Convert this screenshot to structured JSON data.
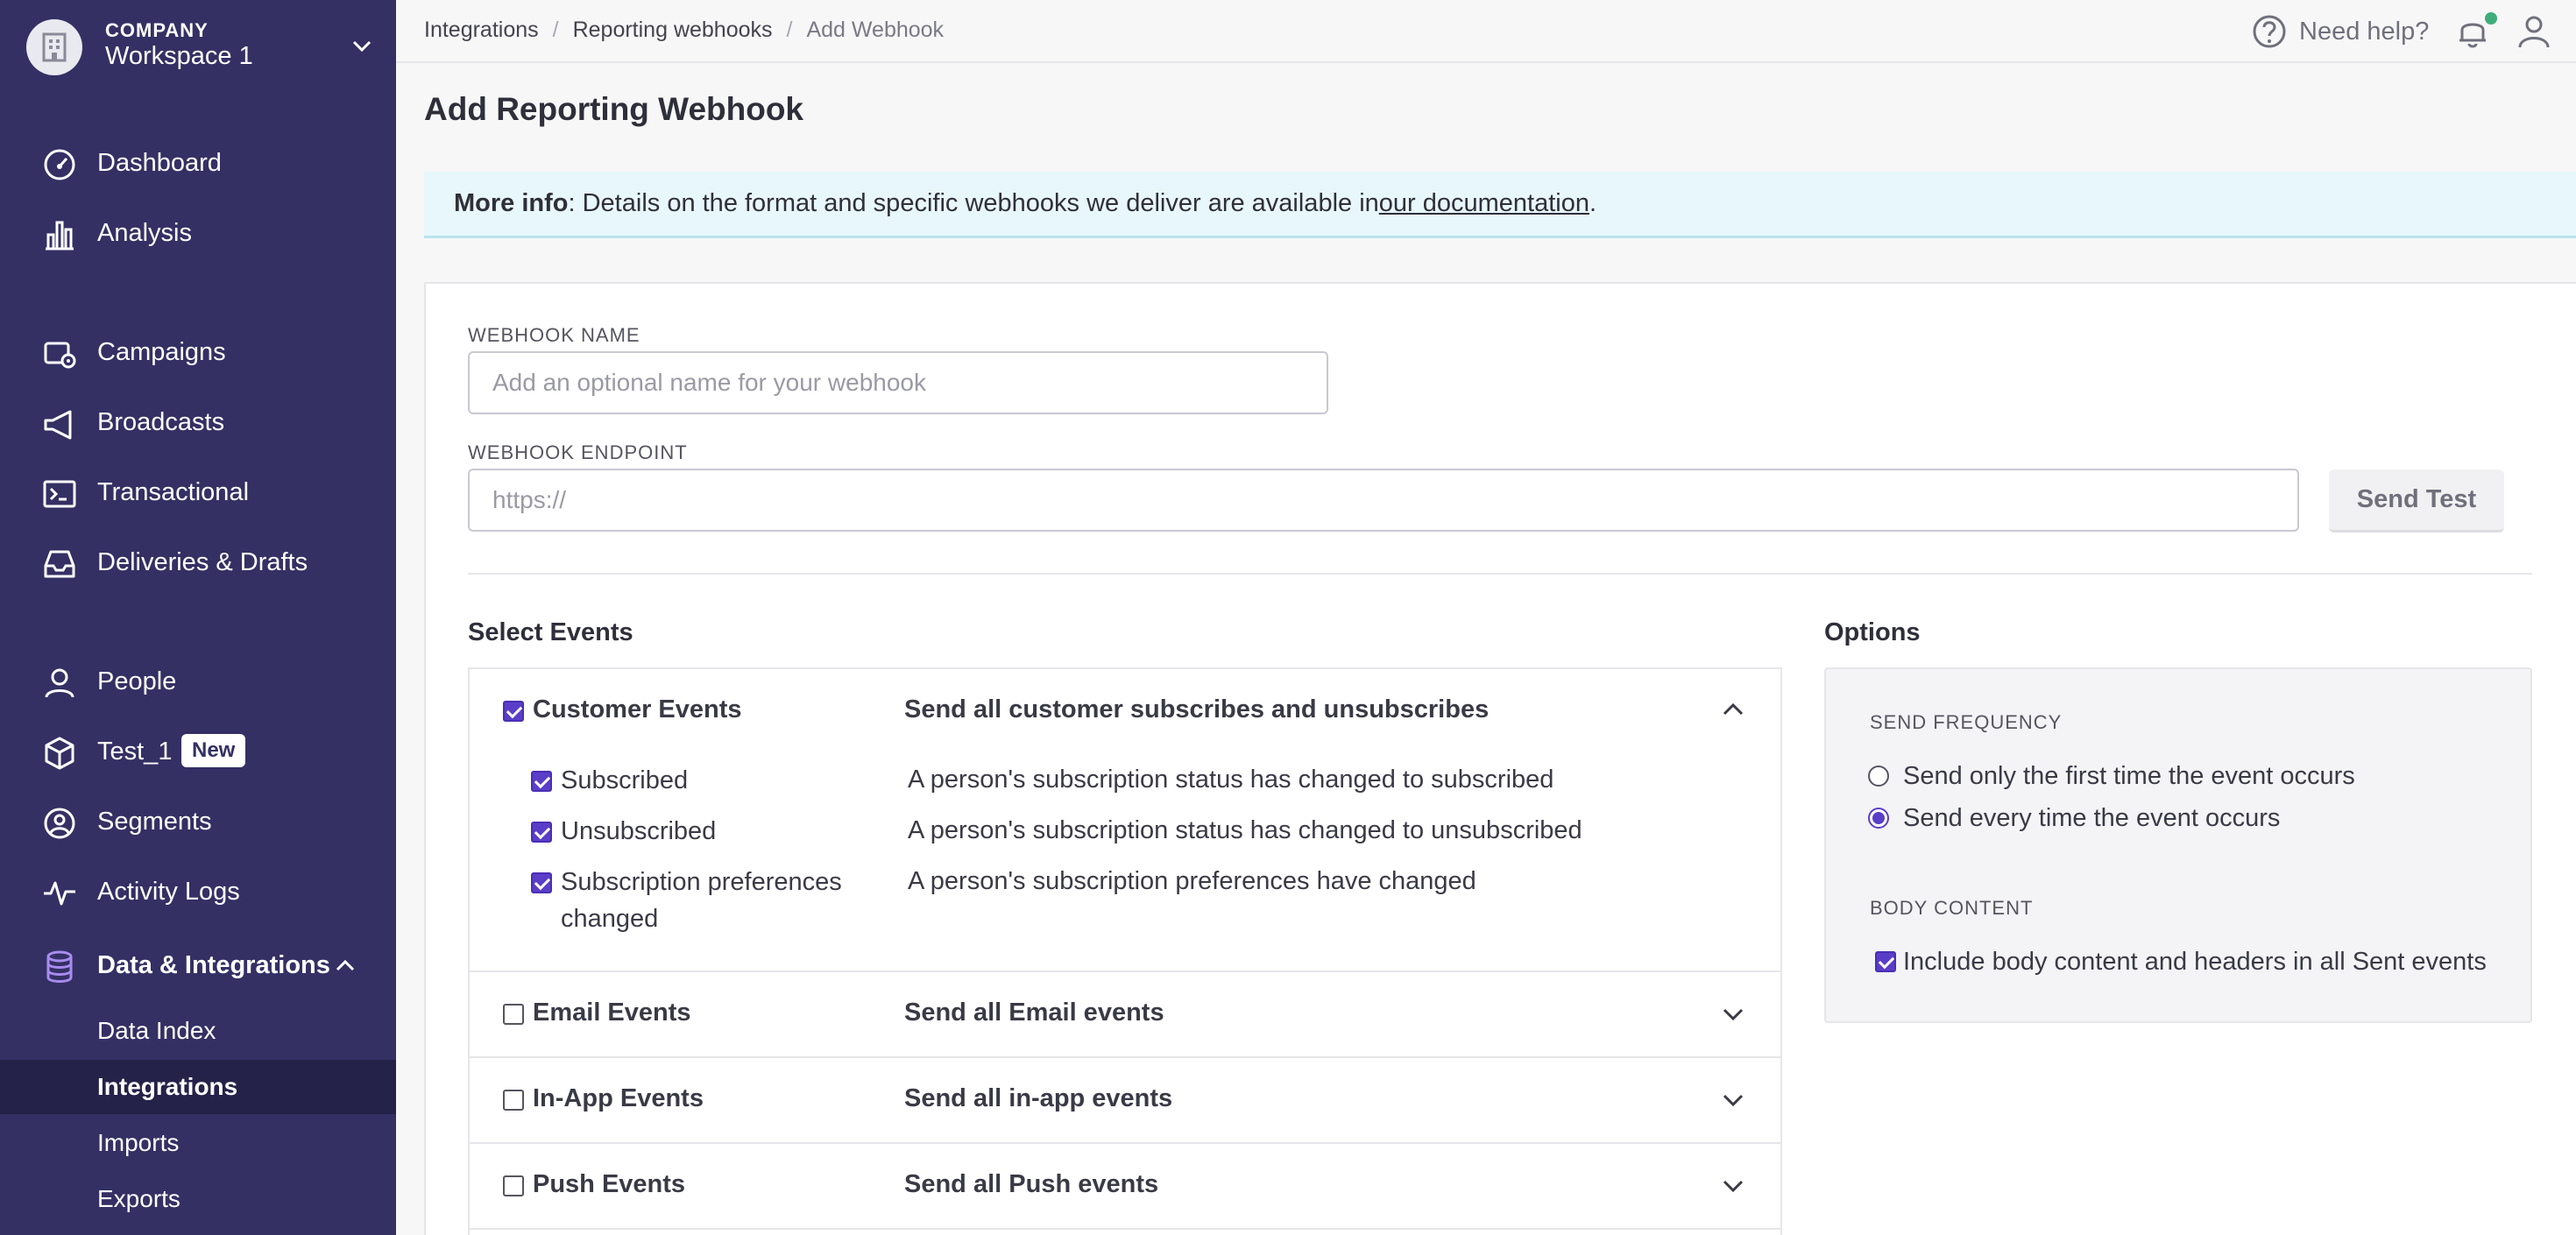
{
  "workspace": {
    "company": "COMPANY",
    "name": "Workspace 1"
  },
  "nav": {
    "dashboard": "Dashboard",
    "analysis": "Analysis",
    "campaigns": "Campaigns",
    "broadcasts": "Broadcasts",
    "transactional": "Transactional",
    "deliveries": "Deliveries & Drafts",
    "people": "People",
    "test1": "Test_1",
    "test1_badge": "New",
    "segments": "Segments",
    "activity": "Activity Logs",
    "data_integrations": "Data & Integrations",
    "sub": {
      "data_index": "Data Index",
      "integrations": "Integrations",
      "imports": "Imports",
      "exports": "Exports"
    }
  },
  "breadcrumb": [
    "Integrations",
    "Reporting webhooks",
    "Add Webhook"
  ],
  "header": {
    "help": "Need help?"
  },
  "page_title": "Add Reporting Webhook",
  "info": {
    "label": "More info",
    "text": ": Details on the format and specific webhooks we deliver are available in ",
    "link": "our documentation",
    "end": "."
  },
  "form": {
    "name_label": "WEBHOOK NAME",
    "name_placeholder": "Add an optional name for your webhook",
    "endpoint_label": "WEBHOOK ENDPOINT",
    "endpoint_placeholder": "https://",
    "send_test": "Send Test"
  },
  "events": {
    "title": "Select Events",
    "groups": [
      {
        "name": "Customer Events",
        "desc": "Send all customer subscribes and unsubscribes",
        "checked": true,
        "expanded": true
      },
      {
        "name": "Email Events",
        "desc": "Send all Email events",
        "checked": false,
        "expanded": false
      },
      {
        "name": "In-App Events",
        "desc": "Send all in-app events",
        "checked": false,
        "expanded": false
      },
      {
        "name": "Push Events",
        "desc": "Send all Push events",
        "checked": false,
        "expanded": false
      }
    ],
    "customer_sub": [
      {
        "name": "Subscribed",
        "desc": "A person's subscription status has changed to subscribed",
        "checked": true
      },
      {
        "name": "Unsubscribed",
        "desc": "A person's subscription status has changed to unsubscribed",
        "checked": true
      },
      {
        "name_line1": "Subscription preferences",
        "name_line2": "changed",
        "desc": "A person's subscription preferences have changed",
        "checked": true
      }
    ]
  },
  "options": {
    "title": "Options",
    "frequency_label": "SEND FREQUENCY",
    "freq_first": "Send only the first time the event occurs",
    "freq_every": "Send every time the event occurs",
    "freq_selected": "every",
    "body_label": "BODY CONTENT",
    "body_include": "Include body content and headers in all Sent events",
    "body_checked": true
  },
  "colors": {
    "sidebar": "#343064",
    "sidebar_active": "#252249",
    "accent": "#5a3ec8",
    "info_bg": "#e8f7fb"
  }
}
